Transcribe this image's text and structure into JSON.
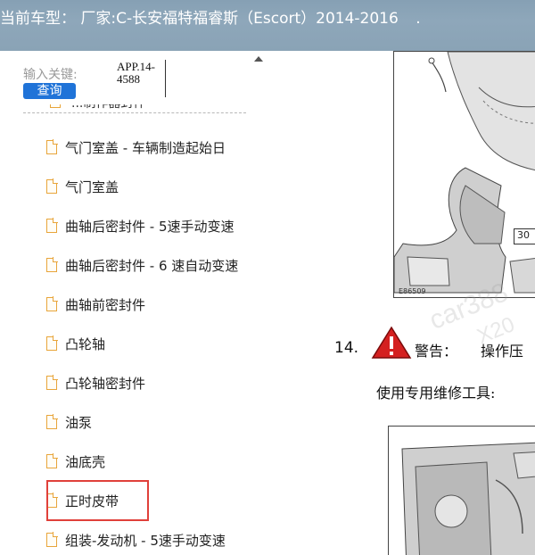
{
  "titlebar": {
    "prefix": "当前车型：",
    "vehicle": "厂家:C-长安福特福睿斯（Escort）2014-2016",
    "suffix": "."
  },
  "search": {
    "label": "输入关键:",
    "value_line1": "APP.14-",
    "value_line2": "4588",
    "button": "查询"
  },
  "tree": {
    "cut_item": "...制作器封件",
    "items": [
      {
        "label": "气门室盖 - 车辆制造起始日"
      },
      {
        "label": "气门室盖"
      },
      {
        "label": "曲轴后密封件 - 5速手动变速"
      },
      {
        "label": "曲轴后密封件 - 6 速自动变速"
      },
      {
        "label": "曲轴前密封件"
      },
      {
        "label": "凸轮轴"
      },
      {
        "label": "凸轮轴密封件"
      },
      {
        "label": "油泵"
      },
      {
        "label": "油底壳"
      },
      {
        "label": "正时皮带",
        "highlighted": true
      },
      {
        "label": "组装-发动机 - 5速手动变速"
      }
    ]
  },
  "document": {
    "figure_code": "E86509",
    "figure_callout": "30",
    "step_number": "14.",
    "warning_label": "警告：",
    "warning_text": "操作压",
    "tool_line": "使用专用维修工具:",
    "watermark_1": "car388",
    "watermark_2": "X20"
  },
  "colors": {
    "titlebar": "#8aa3b6",
    "search_button": "#1f73d8",
    "doc_icon": "#e8a53a",
    "highlight": "#e0403a",
    "warning": "#d42020"
  },
  "icons": {
    "tree_item": "document-icon",
    "warning": "warning-triangle-icon",
    "scroll": "scroll-up-arrow-icon"
  }
}
